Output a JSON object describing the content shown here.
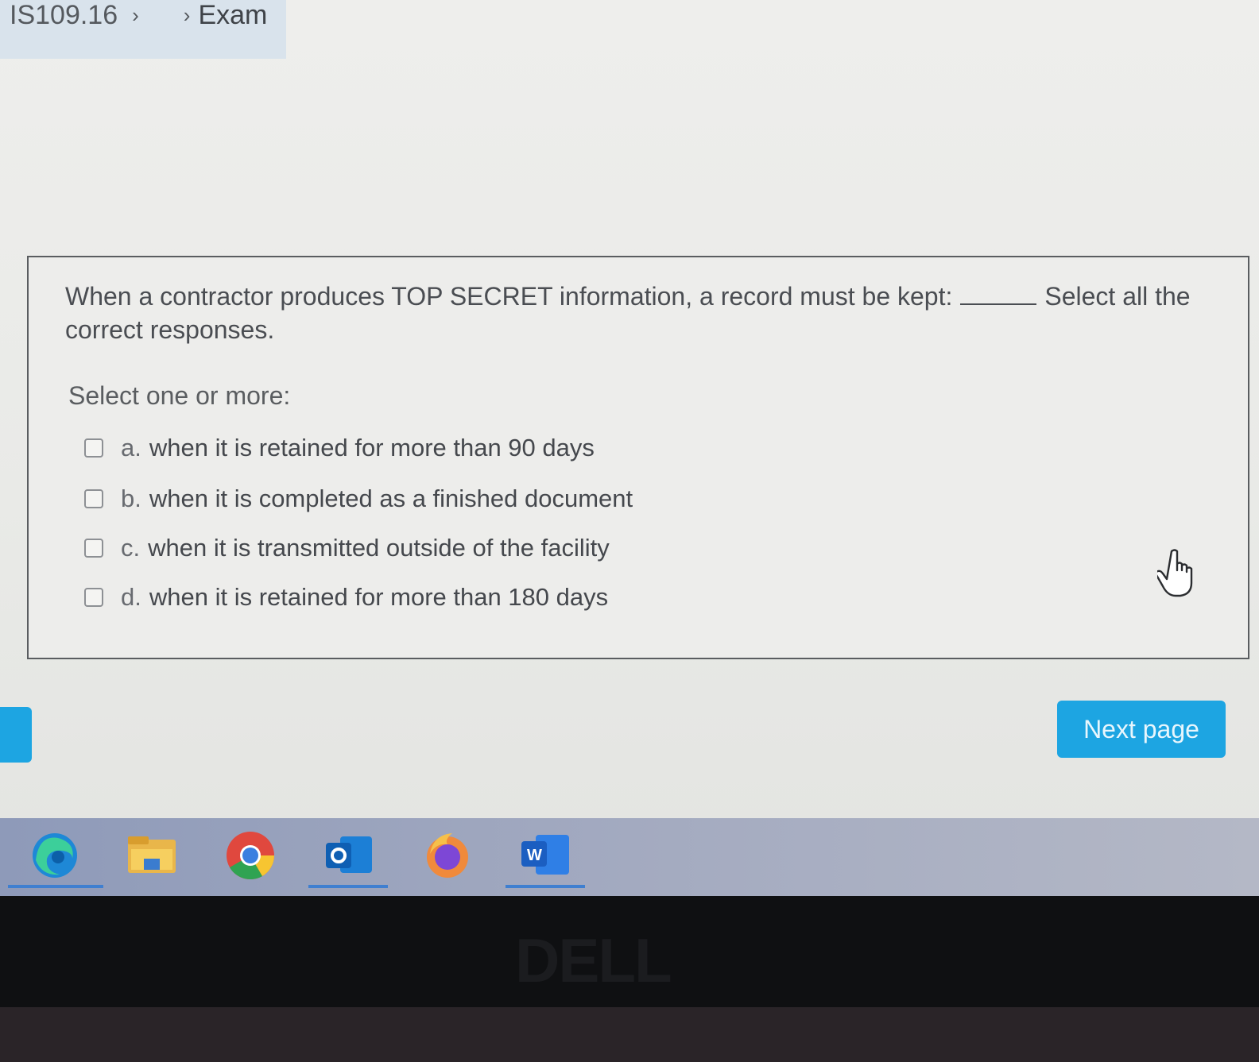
{
  "breadcrumb": {
    "course": "IS109.16",
    "page": "Exam"
  },
  "question": {
    "text_before": "When a contractor produces TOP SECRET information, a record must be kept:",
    "text_after": "Select all the correct responses.",
    "prompt": "Select one or more:",
    "options": [
      {
        "letter": "a.",
        "text": "when it is retained for more than 90 days",
        "checked": false
      },
      {
        "letter": "b.",
        "text": "when it is completed as a finished document",
        "checked": false
      },
      {
        "letter": "c.",
        "text": "when it is transmitted outside of the facility",
        "checked": false
      },
      {
        "letter": "d.",
        "text": "when it is retained for more than 180 days",
        "checked": false
      }
    ]
  },
  "navigation": {
    "next_label": "Next page"
  },
  "taskbar": {
    "apps": [
      "edge-icon",
      "file-explorer-icon",
      "chrome-icon",
      "outlook-icon",
      "firefox-icon",
      "word-icon"
    ]
  },
  "device": {
    "brand": "DELL"
  },
  "colors": {
    "accent": "#1da5e2",
    "taskbar": "#9aa4bf"
  }
}
